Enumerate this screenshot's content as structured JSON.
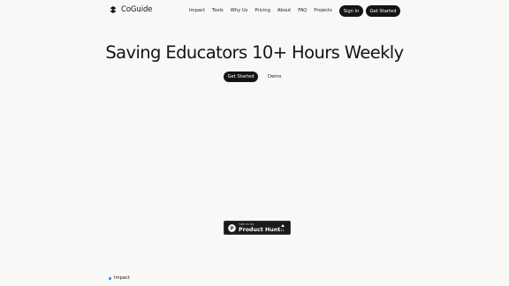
{
  "brand": {
    "name": "CoGuide",
    "logo_icon": "coguide-logo-icon"
  },
  "nav": {
    "links": [
      "Impact",
      "Tools",
      "Why Us",
      "Pricing",
      "About",
      "FAQ",
      "Projects"
    ],
    "signin_label": "Sign In",
    "get_started_label": "Get Started"
  },
  "hero": {
    "title": "Saving Educators 10+ Hours Weekly",
    "cta_label": "Get Started",
    "demo_label": "Demo"
  },
  "product_hunt": {
    "small_text": "FIND US ON",
    "name": "Product Hunt",
    "upvotes": "11",
    "logo_icon": "product-hunt-icon"
  },
  "section": {
    "label": "Impact",
    "dot_color": "#2a7fff"
  },
  "colors": {
    "background": "#f8f8f6",
    "button": "#141414",
    "badge": "#1b1b1b"
  }
}
